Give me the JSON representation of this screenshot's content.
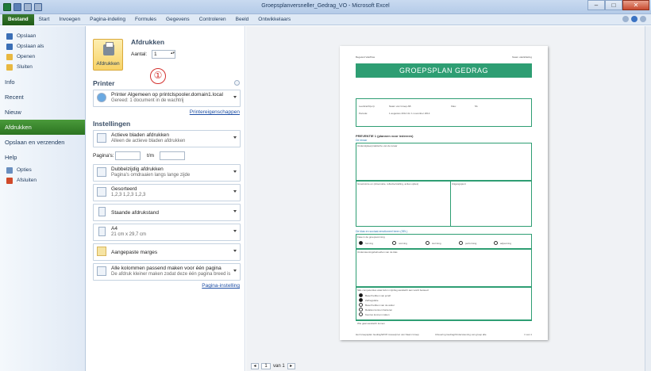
{
  "window": {
    "title": "Groepsplanversneller_Gedrag_VO  -  Microsoft Excel",
    "minimize": "–",
    "maximize": "□",
    "close": "✕"
  },
  "ribbon_tabs": [
    "Bestand",
    "Start",
    "Invoegen",
    "Pagina-indeling",
    "Formules",
    "Gegevens",
    "Controleren",
    "Beeld",
    "Ontwikkelaars"
  ],
  "nav": {
    "small_top": [
      {
        "label": "Opslaan",
        "icon": "save-icon",
        "color": "#3b6fb6"
      },
      {
        "label": "Opslaan als",
        "icon": "save-as-icon",
        "color": "#3b6fb6"
      },
      {
        "label": "Openen",
        "icon": "open-folder-icon",
        "color": "#e8b840"
      },
      {
        "label": "Sluiten",
        "icon": "close-folder-icon",
        "color": "#e8b840"
      }
    ],
    "big": [
      {
        "label": "Info",
        "active": false
      },
      {
        "label": "Recent",
        "active": false
      },
      {
        "label": "Nieuw",
        "active": false
      },
      {
        "label": "Afdrukken",
        "active": true
      },
      {
        "label": "Opslaan en verzenden",
        "active": false
      },
      {
        "label": "Help",
        "active": false
      }
    ],
    "small_bottom": [
      {
        "label": "Opties",
        "icon": "options-icon",
        "color": "#6a8fbf"
      },
      {
        "label": "Afsluiten",
        "icon": "exit-icon",
        "color": "#d04a2a"
      }
    ]
  },
  "print": {
    "heading": "Afdrukken",
    "button_label": "Afdrukken",
    "copies_label": "Aantal:",
    "copies_value": "1",
    "marker": "①"
  },
  "printer": {
    "heading": "Printer",
    "name": "Printer Algemeen op printclspooler.domain1.local",
    "status": "Gereed: 1 document in de wachtrij",
    "properties_link": "Printereigenschappen"
  },
  "settings": {
    "heading": "Instellingen",
    "what": {
      "t1": "Actieve bladen afdrukken",
      "t2": "Alleen de actieve bladen afdrukken"
    },
    "pages_label": "Pagina's:",
    "pages_to": "t/m",
    "duplex": {
      "t1": "Dubbelzijdig afdrukken",
      "t2": "Pagina's omdraaien langs lange zijde"
    },
    "collate": {
      "t1": "Gesorteerd",
      "t2": "1,2,3   1,2,3   1,2,3"
    },
    "orientation": {
      "t1": "Staande afdrukstand"
    },
    "paper": {
      "t1": "A4",
      "t2": "21 cm x 29,7 cm"
    },
    "margins": {
      "t1": "Aangepaste marges"
    },
    "scaling": {
      "t1": "Alle kolommen passend maken voor één pagina",
      "t2": "De afdruk kleiner maken zodat deze één pagina breed is"
    },
    "page_setup_link": "Pagina-instelling"
  },
  "preview": {
    "page_current": "1",
    "page_total": "van 1",
    "doc": {
      "top_left": "Begeleid Vak/Klas",
      "top_right": "Naam vak/afdeling",
      "title": "GROEPSPLAN GEDRAG",
      "info_rows": [
        {
          "label": "Leerkracht(en):",
          "value": "Naam van Groep AB",
          "label2": "Klas:",
          "value2": "5A"
        },
        {
          "label": "Periode:",
          "value": "1 augustus 2014 t/m 1 november 2014",
          "label2": "",
          "value2": ""
        }
      ],
      "section1": "PREVENTIE 1 (plannen voor iedereen)",
      "section1_sub": "De leraar",
      "box1": "Onderwijsleerpraktische van de leraar",
      "box2a": "Groeiruimte en (observatie, reflectie/stelling, acties opties)",
      "box2b": "Uitgangspunt",
      "section2": "De klas en sociaal-emotioneel leren (SEL)",
      "phases_label": "Fase in de groepsvorming",
      "phases": [
        "forming",
        "norming",
        "storming",
        "performing",
        "adjourning"
      ],
      "box3": "Ondersteuningsbehoeften van de klas",
      "box4": "SEL competenties waar ik/om mijn/leg aandacht aan wordt besteed:",
      "sel_items": [
        "Besef hebben van jezelf",
        "Zelfregulatie",
        "Besef hebben van de ander",
        "Relaties kunnen hanteren",
        "Keuzes kunnen maken"
      ],
      "box5": "Wie gaat aandacht komen",
      "footer_left": "Het Groepsplan Gedrag/WOP niveau/proc van Naam Groep",
      "footer_mid": "Uitvoering Gedrag/Ondersteuning van groep alle",
      "footer_right": "1 van 1"
    }
  },
  "colors": {
    "file_tab": "#2c7421",
    "active_nav": "#2c7421",
    "print_button": "#f7d266",
    "doc_accent": "#2e9e73",
    "marker": "#d3322f"
  }
}
